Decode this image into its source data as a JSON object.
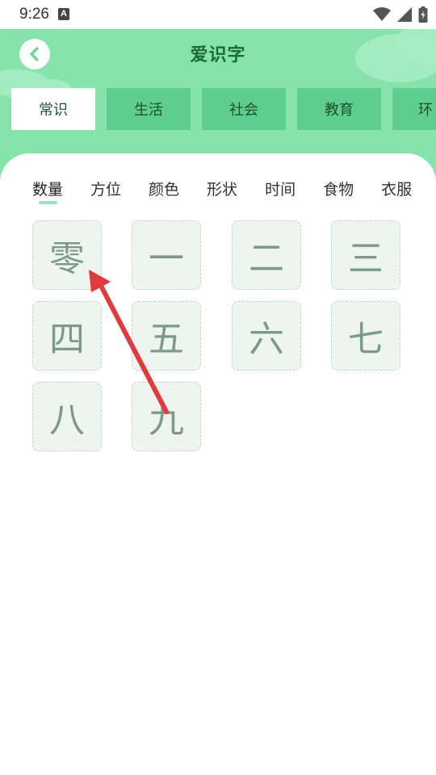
{
  "status_bar": {
    "time": "9:26",
    "notification_icon": "A"
  },
  "header": {
    "title": "爱识字",
    "back_icon": "chevron-left-icon"
  },
  "tabs": [
    {
      "label": "常识",
      "active": true
    },
    {
      "label": "生活",
      "active": false
    },
    {
      "label": "社会",
      "active": false
    },
    {
      "label": "教育",
      "active": false
    },
    {
      "label": "环",
      "active": false
    }
  ],
  "sub_tabs": [
    {
      "label": "数量",
      "active": true
    },
    {
      "label": "方位",
      "active": false
    },
    {
      "label": "颜色",
      "active": false
    },
    {
      "label": "形状",
      "active": false
    },
    {
      "label": "时间",
      "active": false
    },
    {
      "label": "食物",
      "active": false
    },
    {
      "label": "衣服",
      "active": false
    }
  ],
  "characters": [
    "零",
    "一",
    "二",
    "三",
    "四",
    "五",
    "六",
    "七",
    "八",
    "九"
  ],
  "colors": {
    "header_green": "#86e3ab",
    "tab_green": "#5fcd8e",
    "title_green": "#1d6b36",
    "cell_bg": "#eef5f0",
    "char_color": "#7c9a86",
    "arrow_red": "#e0393e"
  }
}
